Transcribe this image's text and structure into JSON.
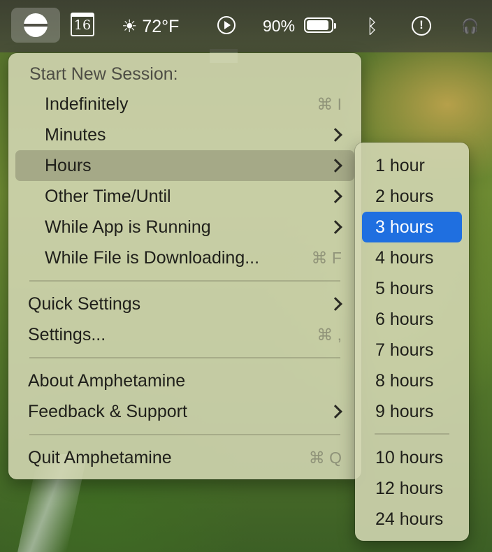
{
  "menubar": {
    "calendar_day": "16",
    "weather": "☀ 72°F",
    "battery_percent": "90%",
    "battery_level": 0.9
  },
  "main_menu": {
    "header": "Start New Session:",
    "items": [
      {
        "label": "Indefinitely",
        "shortcut": "⌘ I"
      },
      {
        "label": "Minutes",
        "submenu": true
      },
      {
        "label": "Hours",
        "submenu": true,
        "highlighted": true
      },
      {
        "label": "Other Time/Until",
        "submenu": true
      },
      {
        "label": "While App is Running",
        "submenu": true
      },
      {
        "label": "While File is Downloading...",
        "shortcut": "⌘ F"
      },
      {
        "label": "Quick Settings",
        "submenu": true
      },
      {
        "label": "Settings...",
        "shortcut": "⌘ ,"
      },
      {
        "label": "About Amphetamine"
      },
      {
        "label": "Feedback & Support",
        "submenu": true
      },
      {
        "label": "Quit Amphetamine",
        "shortcut": "⌘ Q"
      }
    ]
  },
  "hours_submenu": {
    "items": [
      "1 hour",
      "2 hours",
      "3 hours",
      "4 hours",
      "5 hours",
      "6 hours",
      "7 hours",
      "8 hours",
      "9 hours",
      "10 hours",
      "12 hours",
      "24 hours"
    ],
    "selected": "3 hours"
  },
  "colors": {
    "selection": "#1f6fe0",
    "menu_bg": "#d4d7b4"
  }
}
